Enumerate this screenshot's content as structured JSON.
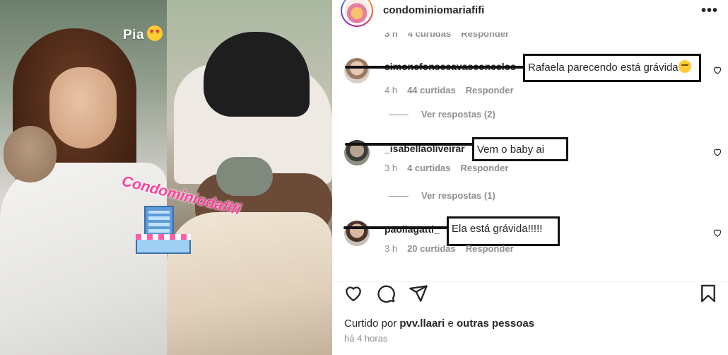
{
  "story": {
    "caption": "Pia",
    "caption_emoji": "heart-eyes-emoji",
    "watermark_text": "Condominiodafifi"
  },
  "post": {
    "username": "condominiomariafifi",
    "more_label": "•••",
    "cut_row": {
      "time": "3 h",
      "likes": "4 curtidas",
      "reply": "Responder"
    }
  },
  "comments": [
    {
      "username": "simonefonsecavasconcelos",
      "text": "Rafaela parecendo está grávida",
      "emoji": "thinking-face-emoji",
      "time": "4 h",
      "likes": "44 curtidas",
      "reply": "Responder",
      "replies_label": "Ver respostas (2)"
    },
    {
      "username": "_isabellaoliveirar",
      "text": "Vem o baby ai",
      "time": "3 h",
      "likes": "4 curtidas",
      "reply": "Responder",
      "replies_label": "Ver respostas (1)"
    },
    {
      "username": "paollagatti_",
      "text": "Ela está grávida!!!!!",
      "time": "3 h",
      "likes": "20 curtidas",
      "reply": "Responder"
    }
  ],
  "actions": [
    "heart-icon",
    "comment-icon",
    "share-icon",
    "bookmark-icon"
  ],
  "liked_by": {
    "prefix": "Curtido por",
    "user": "pvv.llaari",
    "joiner": "e",
    "others": "outras pessoas"
  },
  "posted_time": "há 4 horas",
  "colors": {
    "text": "#262626",
    "muted": "#8e8e8e",
    "watermark": "#ff3f9a"
  }
}
